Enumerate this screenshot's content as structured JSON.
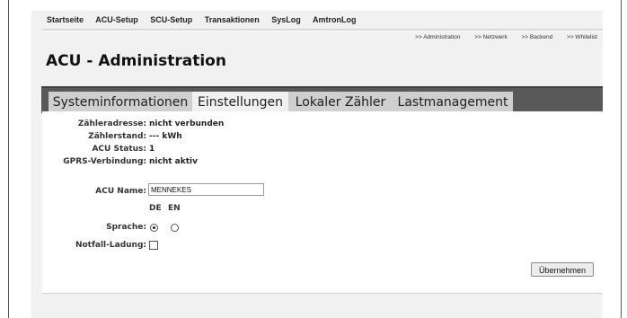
{
  "top_nav": {
    "items": [
      "Startseite",
      "ACU-Setup",
      "SCU-Setup",
      "Transaktionen",
      "SysLog",
      "AmtronLog"
    ]
  },
  "sub_nav": {
    "items": [
      ">> Administration",
      ">> Netzwerk",
      ">> Backend",
      ">> Whitelist"
    ]
  },
  "page_title": "ACU - Administration",
  "tabs": [
    {
      "label": "Systeminformationen",
      "state": "inactive"
    },
    {
      "label": "Einstellungen",
      "state": "active"
    },
    {
      "label": "Lokaler Zähler",
      "state": "inactive"
    },
    {
      "label": "Lastmanagement",
      "state": "inactive"
    }
  ],
  "info": {
    "zaehleradresse_label": "Zähleradresse:",
    "zaehleradresse_value": "nicht verbunden",
    "zaehlerstand_label": "Zählerstand:",
    "zaehlerstand_value": "--- kWh",
    "acu_status_label": "ACU Status:",
    "acu_status_value": "1",
    "gprs_label": "GPRS-Verbindung:",
    "gprs_value": "nicht aktiv"
  },
  "form": {
    "acu_name_label": "ACU Name:",
    "acu_name_value": "MENNEKES",
    "lang_de": "DE",
    "lang_en": "EN",
    "sprache_label": "Sprache:",
    "sprache_selected": "DE",
    "notfall_label": "Notfall-Ladung:",
    "notfall_checked": false,
    "submit_label": "Übernehmen"
  }
}
